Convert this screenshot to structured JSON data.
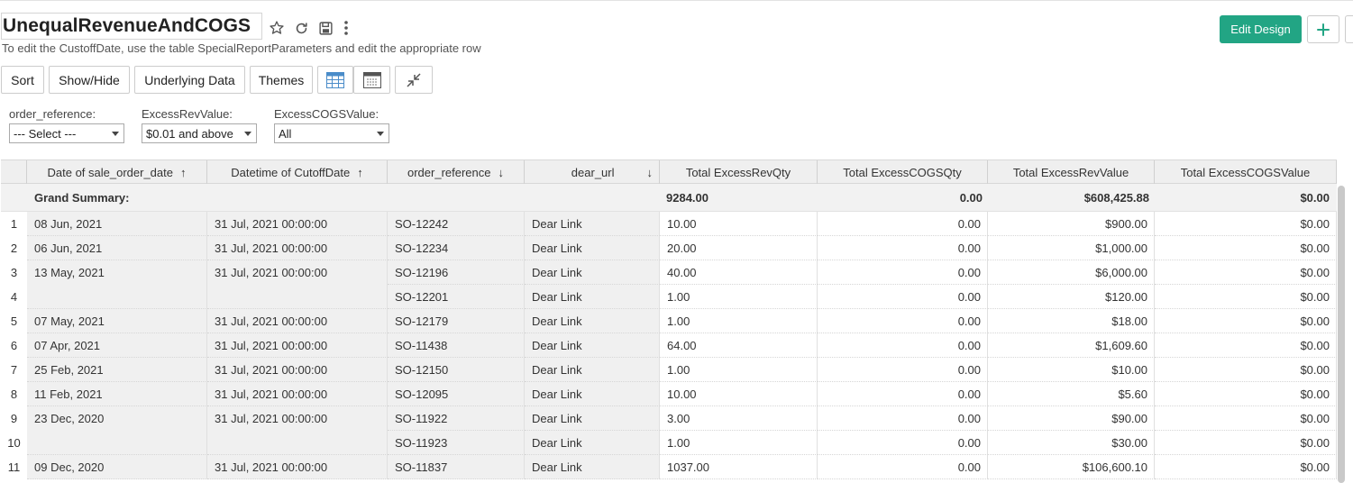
{
  "report": {
    "title": "UnequalRevenueAndCOGS",
    "subtitle": "To edit the CustoffDate, use the table SpecialReportParameters and edit the appropriate row"
  },
  "icons": {
    "favorite": "star-icon",
    "refresh": "refresh-icon",
    "save": "save-icon",
    "more": "more-vertical-icon",
    "add": "plus-icon",
    "table_view": "table-view-icon",
    "pivot_view": "pivot-view-icon",
    "collapse": "collapse-icon"
  },
  "colors": {
    "accent": "#22a584",
    "plus": "#22a584"
  },
  "actions": {
    "edit_design": "Edit Design"
  },
  "toolbar": {
    "sort": "Sort",
    "show_hide": "Show/Hide",
    "underlying_data": "Underlying Data",
    "themes": "Themes"
  },
  "filters": [
    {
      "label": "order_reference:",
      "selected": "--- Select ---"
    },
    {
      "label": "ExcessRevValue:",
      "selected": "$0.01 and above"
    },
    {
      "label": "ExcessCOGSValue:",
      "selected": "All"
    }
  ],
  "table": {
    "columns": [
      {
        "label": "Date of sale_order_date",
        "sort": "↑"
      },
      {
        "label": "Datetime of CutoffDate",
        "sort": "↑"
      },
      {
        "label": "order_reference",
        "sort": "↓"
      },
      {
        "label": "dear_url",
        "sort": "↓"
      },
      {
        "label": "Total ExcessRevQty",
        "sort": ""
      },
      {
        "label": "Total ExcessCOGSQty",
        "sort": ""
      },
      {
        "label": "Total ExcessRevValue",
        "sort": ""
      },
      {
        "label": "Total ExcessCOGSValue",
        "sort": ""
      }
    ],
    "summary": {
      "label": "Grand Summary:",
      "rev_qty": "9284.00",
      "cogs_qty": "0.00",
      "rev_value": "$608,425.88",
      "cogs_value": "$0.00"
    },
    "rows": [
      {
        "n": "1",
        "date": "08 Jun, 2021",
        "cutoff": "31 Jul, 2021 00:00:00",
        "ref": "SO-12242",
        "url": "Dear Link",
        "rev_qty": "10.00",
        "cogs_qty": "0.00",
        "rev_value": "$900.00",
        "cogs_value": "$0.00"
      },
      {
        "n": "2",
        "date": "06 Jun, 2021",
        "cutoff": "31 Jul, 2021 00:00:00",
        "ref": "SO-12234",
        "url": "Dear Link",
        "rev_qty": "20.00",
        "cogs_qty": "0.00",
        "rev_value": "$1,000.00",
        "cogs_value": "$0.00"
      },
      {
        "n": "3",
        "date": "13 May, 2021",
        "cutoff": "31 Jul, 2021 00:00:00",
        "ref": "SO-12196",
        "url": "Dear Link",
        "rev_qty": "40.00",
        "cogs_qty": "0.00",
        "rev_value": "$6,000.00",
        "cogs_value": "$0.00"
      },
      {
        "n": "4",
        "date": "",
        "cutoff": "",
        "ref": "SO-12201",
        "url": "Dear Link",
        "rev_qty": "1.00",
        "cogs_qty": "0.00",
        "rev_value": "$120.00",
        "cogs_value": "$0.00"
      },
      {
        "n": "5",
        "date": "07 May, 2021",
        "cutoff": "31 Jul, 2021 00:00:00",
        "ref": "SO-12179",
        "url": "Dear Link",
        "rev_qty": "1.00",
        "cogs_qty": "0.00",
        "rev_value": "$18.00",
        "cogs_value": "$0.00"
      },
      {
        "n": "6",
        "date": "07 Apr, 2021",
        "cutoff": "31 Jul, 2021 00:00:00",
        "ref": "SO-11438",
        "url": "Dear Link",
        "rev_qty": "64.00",
        "cogs_qty": "0.00",
        "rev_value": "$1,609.60",
        "cogs_value": "$0.00"
      },
      {
        "n": "7",
        "date": "25 Feb, 2021",
        "cutoff": "31 Jul, 2021 00:00:00",
        "ref": "SO-12150",
        "url": "Dear Link",
        "rev_qty": "1.00",
        "cogs_qty": "0.00",
        "rev_value": "$10.00",
        "cogs_value": "$0.00"
      },
      {
        "n": "8",
        "date": "11 Feb, 2021",
        "cutoff": "31 Jul, 2021 00:00:00",
        "ref": "SO-12095",
        "url": "Dear Link",
        "rev_qty": "10.00",
        "cogs_qty": "0.00",
        "rev_value": "$5.60",
        "cogs_value": "$0.00"
      },
      {
        "n": "9",
        "date": "23 Dec, 2020",
        "cutoff": "31 Jul, 2021 00:00:00",
        "ref": "SO-11922",
        "url": "Dear Link",
        "rev_qty": "3.00",
        "cogs_qty": "0.00",
        "rev_value": "$90.00",
        "cogs_value": "$0.00"
      },
      {
        "n": "10",
        "date": "",
        "cutoff": "",
        "ref": "SO-11923",
        "url": "Dear Link",
        "rev_qty": "1.00",
        "cogs_qty": "0.00",
        "rev_value": "$30.00",
        "cogs_value": "$0.00"
      },
      {
        "n": "11",
        "date": "09 Dec, 2020",
        "cutoff": "31 Jul, 2021 00:00:00",
        "ref": "SO-11837",
        "url": "Dear Link",
        "rev_qty": "1037.00",
        "cogs_qty": "0.00",
        "rev_value": "$106,600.10",
        "cogs_value": "$0.00"
      }
    ]
  }
}
